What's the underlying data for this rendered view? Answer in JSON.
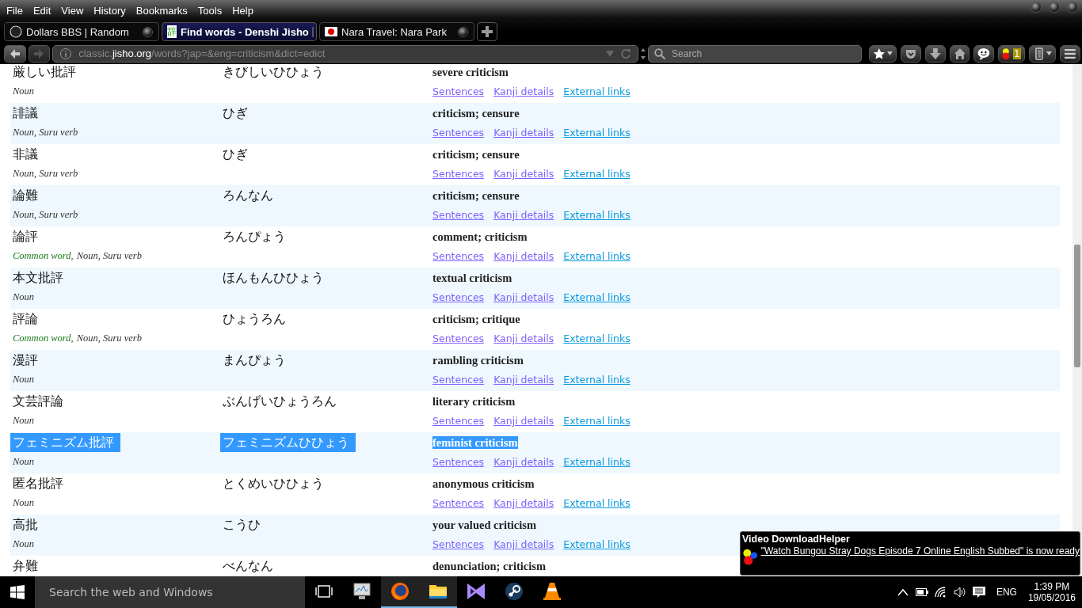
{
  "menu": [
    "File",
    "Edit",
    "View",
    "History",
    "Bookmarks",
    "Tools",
    "Help"
  ],
  "tabs": [
    {
      "title": "Dollars BBS | Random",
      "kind": "circle",
      "selected": false
    },
    {
      "title": "Find words - Denshi Jisho",
      "kind": "kanji",
      "favicon_text": "辞",
      "selected": true
    },
    {
      "title": "Nara Travel: Nara Park",
      "kind": "flag",
      "selected": false
    }
  ],
  "nav": {
    "back_disabled": false,
    "forward_disabled": true,
    "url": {
      "subdomain": "classic.",
      "domain": "jisho.org",
      "path": "/words?jap=&eng=criticism&dict=edict"
    },
    "search_placeholder": "Search",
    "addon_badge": "1"
  },
  "results": [
    {
      "word": "厳しい批評",
      "reading": "きびしいひひょう",
      "meaning": "severe criticism",
      "pos": "Noun",
      "selected": false,
      "links": [
        {
          "text": "Sentences",
          "visited": true
        },
        {
          "text": "Kanji details",
          "visited": true
        },
        {
          "text": "External links",
          "visited": false
        }
      ]
    },
    {
      "word": "誹議",
      "reading": "ひぎ",
      "meaning": "criticism; censure",
      "pos": "Noun, Suru verb",
      "selected": false,
      "links": [
        {
          "text": "Sentences",
          "visited": true
        },
        {
          "text": "Kanji details",
          "visited": true
        },
        {
          "text": "External links",
          "visited": false
        }
      ]
    },
    {
      "word": "非議",
      "reading": "ひぎ",
      "meaning": "criticism; censure",
      "pos": "Noun, Suru verb",
      "selected": false,
      "links": [
        {
          "text": "Sentences",
          "visited": true
        },
        {
          "text": "Kanji details",
          "visited": true
        },
        {
          "text": "External links",
          "visited": false
        }
      ]
    },
    {
      "word": "論難",
      "reading": "ろんなん",
      "meaning": "criticism; censure",
      "pos": "Noun, Suru verb",
      "selected": false,
      "links": [
        {
          "text": "Sentences",
          "visited": true
        },
        {
          "text": "Kanji details",
          "visited": true
        },
        {
          "text": "External links",
          "visited": false
        }
      ]
    },
    {
      "word": "論評",
      "reading": "ろんぴょう",
      "meaning": "comment; criticism",
      "common": "Common word,",
      "pos": "Noun, Suru verb",
      "selected": false,
      "links": [
        {
          "text": "Sentences",
          "visited": true
        },
        {
          "text": "Kanji details",
          "visited": true
        },
        {
          "text": "External links",
          "visited": false
        }
      ]
    },
    {
      "word": "本文批評",
      "reading": "ほんもんひひょう",
      "meaning": "textual criticism",
      "pos": "Noun",
      "selected": false,
      "links": [
        {
          "text": "Sentences",
          "visited": true
        },
        {
          "text": "Kanji details",
          "visited": true
        },
        {
          "text": "External links",
          "visited": false
        }
      ]
    },
    {
      "word": "評論",
      "reading": "ひょうろん",
      "meaning": "criticism; critique",
      "common": "Common word,",
      "pos": "Noun, Suru verb",
      "selected": false,
      "links": [
        {
          "text": "Sentences",
          "visited": true
        },
        {
          "text": "Kanji details",
          "visited": true
        },
        {
          "text": "External links",
          "visited": false
        }
      ]
    },
    {
      "word": "漫評",
      "reading": "まんぴょう",
      "meaning": "rambling criticism",
      "pos": "Noun",
      "selected": false,
      "links": [
        {
          "text": "Sentences",
          "visited": true
        },
        {
          "text": "Kanji details",
          "visited": true
        },
        {
          "text": "External links",
          "visited": false
        }
      ]
    },
    {
      "word": "文芸評論",
      "reading": "ぶんげいひょうろん",
      "meaning": "literary criticism",
      "pos": "Noun",
      "selected": false,
      "links": [
        {
          "text": "Sentences",
          "visited": true
        },
        {
          "text": "Kanji details",
          "visited": true
        },
        {
          "text": "External links",
          "visited": false
        }
      ]
    },
    {
      "word": "フェミニズム批評",
      "reading": "フェミニズムひひょう",
      "meaning": "feminist criticism",
      "pos": "Noun",
      "selected": true,
      "links": [
        {
          "text": "Sentences",
          "visited": true
        },
        {
          "text": "Kanji details",
          "visited": true
        },
        {
          "text": "External links",
          "visited": false
        }
      ]
    },
    {
      "word": "匿名批評",
      "reading": "とくめいひひょう",
      "meaning": "anonymous criticism",
      "pos": "Noun",
      "selected": false,
      "links": [
        {
          "text": "Sentences",
          "visited": true
        },
        {
          "text": "Kanji details",
          "visited": true
        },
        {
          "text": "External links",
          "visited": false
        }
      ]
    },
    {
      "word": "高批",
      "reading": "こうひ",
      "meaning": "your valued criticism",
      "pos": "Noun",
      "selected": false,
      "links": [
        {
          "text": "Sentences",
          "visited": true
        },
        {
          "text": "Kanji details",
          "visited": true
        },
        {
          "text": "External links",
          "visited": false
        }
      ]
    },
    {
      "word": "弁難",
      "reading": "べんなん",
      "meaning": "denunciation; criticism",
      "selected": false
    }
  ],
  "notification": {
    "title": "Video DownloadHelper",
    "message": "\"Watch Bungou Stray Dogs Episode 7 Online English Subbed\" is now ready"
  },
  "taskbar": {
    "search_placeholder": "Search the web and Windows",
    "apps": [
      {
        "kind": "monitor",
        "active": false
      },
      {
        "kind": "firefox",
        "active": true
      },
      {
        "kind": "folder",
        "active": true
      },
      {
        "kind": "studio",
        "active": false
      },
      {
        "kind": "steam",
        "active": false
      },
      {
        "kind": "cone",
        "active": false
      }
    ],
    "language": "ENG",
    "time": "1:39 PM",
    "date": "19/05/2016"
  }
}
